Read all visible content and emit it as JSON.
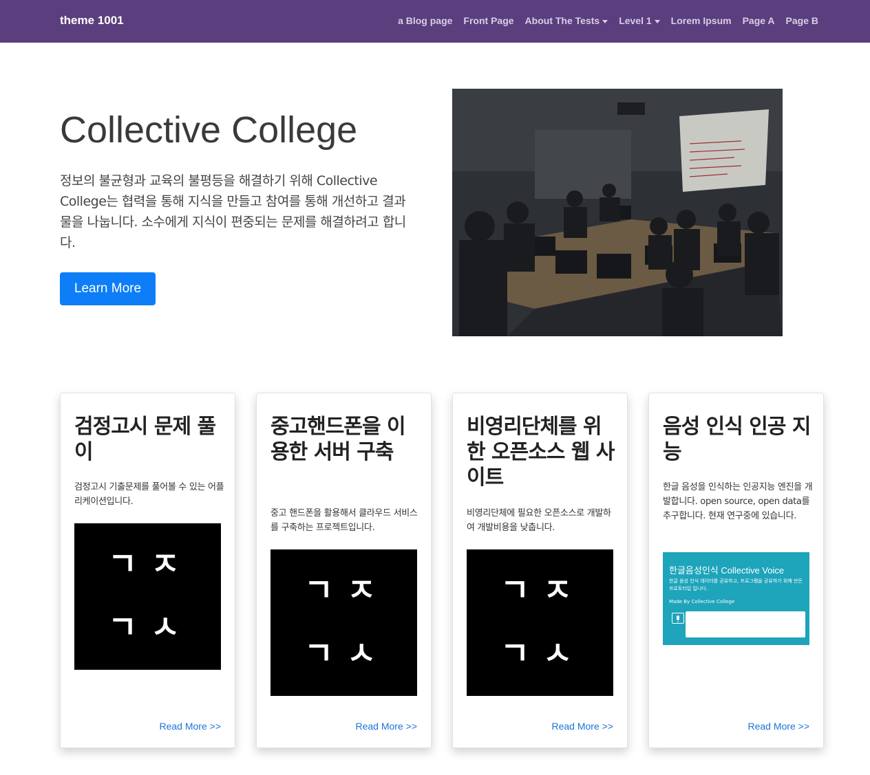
{
  "nav": {
    "brand": "theme 1001",
    "items": [
      {
        "label": "a Blog page",
        "dropdown": false
      },
      {
        "label": "Front Page",
        "dropdown": false
      },
      {
        "label": "About The Tests",
        "dropdown": true
      },
      {
        "label": "Level 1",
        "dropdown": true
      },
      {
        "label": "Lorem Ipsum",
        "dropdown": false
      },
      {
        "label": "Page A",
        "dropdown": false
      },
      {
        "label": "Page B",
        "dropdown": false
      }
    ]
  },
  "hero": {
    "title": "Collective College",
    "text": "정보의 불균형과 교육의 불평등을 해결하기 위해 Collective College는 협력을 통해 지식을 만들고 참여를 통해 개선하고 결과물을 나눕니다. 소수에게 지식이 편중되는 문제를 해결하려고 합니다.",
    "button": "Learn More"
  },
  "cards": [
    {
      "title": "검정고시 문제 풀이",
      "text": "검정고시 기출문제를 풀어볼 수 있는 어플리케이션입니다.",
      "logo": [
        "ㄱ",
        "ㅈ",
        "ㄱ",
        "ㅅ"
      ],
      "link": "Read More >>"
    },
    {
      "title": "중고핸드폰을 이용한 서버 구축",
      "text": "중고 핸드폰을 활용해서 클라우드 서비스를 구축하는 프로젝트입니다.",
      "logo": [
        "ㄱ",
        "ㅈ",
        "ㄱ",
        "ㅅ"
      ],
      "link": "Read More >>"
    },
    {
      "title": "비영리단체를 위한 오픈소스 웹 사이트",
      "text": "비영리단체에 필요한 오픈소스로 개발하여 개발비용을 낮춥니다.",
      "logo": [
        "ㄱ",
        "ㅈ",
        "ㄱ",
        "ㅅ"
      ],
      "link": "Read More >>"
    },
    {
      "title": "음성 인식 인공 지능",
      "text": "한글 음성을 인식하는 인공지능 엔진을 개발합니다. open source, open data를 추구합니다. 현재 연구중에 있습니다.",
      "voice": {
        "title": "한글음성인식 Collective Voice",
        "subtitle": "한글 음성 인식 데이터를 공유하고, 프로그램을 공유하기 위해 만든 프로토타입 입니다.",
        "made_by": "Made By Collective College"
      },
      "link": "Read More >>"
    }
  ]
}
